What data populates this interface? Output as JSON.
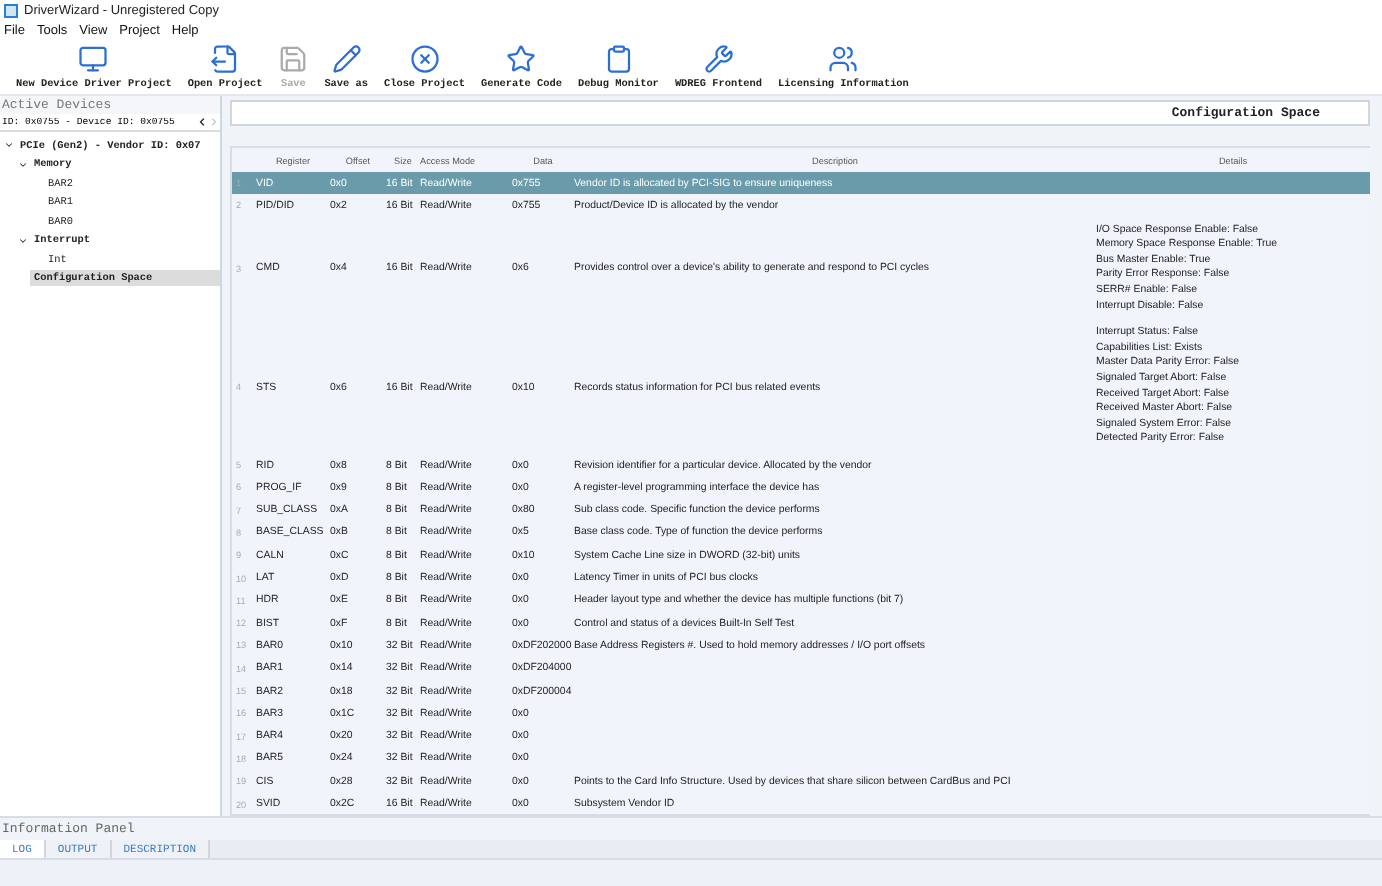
{
  "window": {
    "title": "DriverWizard - Unregistered Copy"
  },
  "menu": [
    "File",
    "Tools",
    "View",
    "Project",
    "Help"
  ],
  "toolbar": [
    {
      "label": "New Device Driver Project",
      "disabled": false
    },
    {
      "label": "Open Project",
      "disabled": false
    },
    {
      "label": "Save",
      "disabled": true
    },
    {
      "label": "Save as",
      "disabled": false
    },
    {
      "label": "Close Project",
      "disabled": false
    },
    {
      "label": "Generate Code",
      "disabled": false
    },
    {
      "label": "Debug Monitor",
      "disabled": false
    },
    {
      "label": "WDREG Frontend",
      "disabled": false
    },
    {
      "label": "Licensing Information",
      "disabled": false
    }
  ],
  "sidebar": {
    "title": "Active Devices",
    "device": "ID: 0x0755 - Device ID: 0x0755",
    "tree": [
      {
        "label": "PCIe (Gen2) - Vendor ID: 0x07",
        "expanded": true,
        "selected": false,
        "children": [
          {
            "label": "Memory",
            "expanded": true,
            "selected": false,
            "children": [
              {
                "label": "BAR2",
                "selected": false
              },
              {
                "label": "BAR1",
                "selected": false
              },
              {
                "label": "BAR0",
                "selected": false
              }
            ]
          },
          {
            "label": "Interrupt",
            "expanded": true,
            "selected": false,
            "children": [
              {
                "label": "Int",
                "selected": false
              }
            ]
          },
          {
            "label": "Configuration Space",
            "selected": true
          }
        ]
      }
    ]
  },
  "panel": {
    "title": "Configuration Space"
  },
  "table": {
    "columns": [
      "Register",
      "Offset",
      "Size",
      "Access Mode",
      "Data",
      "Description",
      "Details"
    ],
    "rows": [
      {
        "num": "1",
        "cells": [
          "VID",
          "0x0",
          "16 Bit",
          "Read/Write",
          "0x755",
          "Vendor ID is allocated by PCI-SIG to ensure uniqueness"
        ],
        "details": [],
        "selected": true
      },
      {
        "num": "2",
        "cells": [
          "PID/DID",
          "0x2",
          "16 Bit",
          "Read/Write",
          "0x755",
          "Product/Device ID is allocated by the vendor"
        ],
        "details": [],
        "selected": false
      },
      {
        "num": "3",
        "cells": [
          "CMD",
          "0x4",
          "16 Bit",
          "Read/Write",
          "0x6",
          "Provides control over a device's ability to generate and respond to PCI cycles"
        ],
        "details": [
          "I/O Space Response Enable: False",
          "Memory Space Response Enable: True",
          "Bus Master Enable: True",
          "Parity Error Response: False",
          "SERR# Enable: False",
          "Interrupt Disable: False"
        ],
        "selected": false
      },
      {
        "num": "4",
        "cells": [
          "STS",
          "0x6",
          "16 Bit",
          "Read/Write",
          "0x10",
          "Records status information for PCI bus related events"
        ],
        "details": [
          "Interrupt Status: False",
          "Capabilities List: Exists",
          "Master Data Parity Error: False",
          "Signaled Target Abort: False",
          "Received Target Abort: False",
          "Received Master Abort: False",
          "Signaled System Error: False",
          "Detected Parity Error: False"
        ],
        "selected": false
      },
      {
        "num": "5",
        "cells": [
          "RID",
          "0x8",
          "8 Bit",
          "Read/Write",
          "0x0",
          "Revision identifier for a particular device. Allocated by the vendor"
        ],
        "details": [],
        "selected": false
      },
      {
        "num": "6",
        "cells": [
          "PROG_IF",
          "0x9",
          "8 Bit",
          "Read/Write",
          "0x0",
          "A register-level programming interface the device has"
        ],
        "details": [],
        "selected": false
      },
      {
        "num": "7",
        "cells": [
          "SUB_CLASS",
          "0xA",
          "8 Bit",
          "Read/Write",
          "0x80",
          "Sub class code. Specific function the device performs"
        ],
        "details": [],
        "selected": false
      },
      {
        "num": "8",
        "cells": [
          "BASE_CLASS",
          "0xB",
          "8 Bit",
          "Read/Write",
          "0x5",
          "Base class code. Type of function the device performs"
        ],
        "details": [],
        "selected": false
      },
      {
        "num": "9",
        "cells": [
          "CALN",
          "0xC",
          "8 Bit",
          "Read/Write",
          "0x10",
          "System Cache Line size in DWORD (32-bit) units"
        ],
        "details": [],
        "selected": false
      },
      {
        "num": "10",
        "cells": [
          "LAT",
          "0xD",
          "8 Bit",
          "Read/Write",
          "0x0",
          "Latency Timer in units of PCI bus clocks"
        ],
        "details": [],
        "selected": false
      },
      {
        "num": "11",
        "cells": [
          "HDR",
          "0xE",
          "8 Bit",
          "Read/Write",
          "0x0",
          "Header layout type and whether the device has multiple functions (bit 7)"
        ],
        "details": [],
        "selected": false
      },
      {
        "num": "12",
        "cells": [
          "BIST",
          "0xF",
          "8 Bit",
          "Read/Write",
          "0x0",
          "Control and status of a devices Built-In Self Test"
        ],
        "details": [],
        "selected": false
      },
      {
        "num": "13",
        "cells": [
          "BAR0",
          "0x10",
          "32 Bit",
          "Read/Write",
          "0xDF202000",
          "Base Address Registers #. Used to hold memory addresses / I/O port offsets"
        ],
        "details": [],
        "selected": false
      },
      {
        "num": "14",
        "cells": [
          "BAR1",
          "0x14",
          "32 Bit",
          "Read/Write",
          "0xDF204000",
          ""
        ],
        "details": [],
        "selected": false
      },
      {
        "num": "15",
        "cells": [
          "BAR2",
          "0x18",
          "32 Bit",
          "Read/Write",
          "0xDF200004",
          ""
        ],
        "details": [],
        "selected": false
      },
      {
        "num": "16",
        "cells": [
          "BAR3",
          "0x1C",
          "32 Bit",
          "Read/Write",
          "0x0",
          ""
        ],
        "details": [],
        "selected": false
      },
      {
        "num": "17",
        "cells": [
          "BAR4",
          "0x20",
          "32 Bit",
          "Read/Write",
          "0x0",
          ""
        ],
        "details": [],
        "selected": false
      },
      {
        "num": "18",
        "cells": [
          "BAR5",
          "0x24",
          "32 Bit",
          "Read/Write",
          "0x0",
          ""
        ],
        "details": [],
        "selected": false
      },
      {
        "num": "19",
        "cells": [
          "CIS",
          "0x28",
          "32 Bit",
          "Read/Write",
          "0x0",
          "Points to the Card Info Structure. Used by devices that share silicon between CardBus and PCI"
        ],
        "details": [],
        "selected": false
      },
      {
        "num": "20",
        "cells": [
          "SVID",
          "0x2C",
          "16 Bit",
          "Read/Write",
          "0x0",
          "Subsystem Vendor ID"
        ],
        "details": [],
        "selected": false
      }
    ]
  },
  "info_panel": {
    "title": "Information Panel",
    "tabs": [
      {
        "label": "LOG",
        "selected": true
      },
      {
        "label": "OUTPUT",
        "selected": false
      },
      {
        "label": "DESCRIPTION",
        "selected": false
      }
    ]
  }
}
